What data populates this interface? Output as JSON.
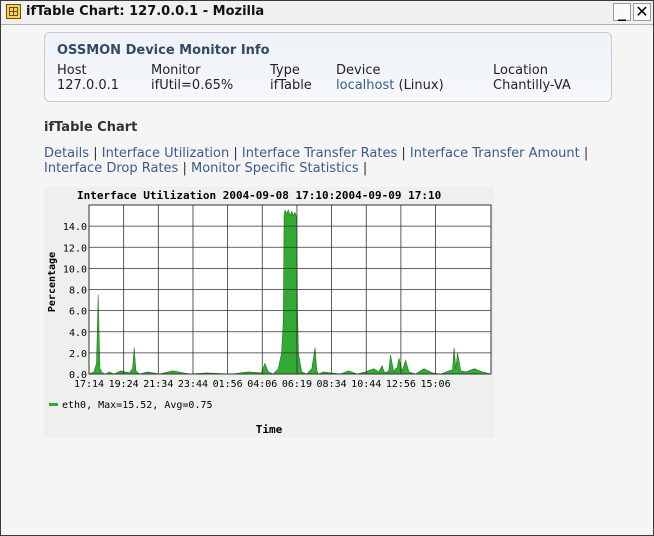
{
  "window": {
    "title": "ifTable Chart: 127.0.0.1 - Mozilla",
    "min_label": "_",
    "close_label": "✕"
  },
  "info": {
    "title": "OSSMON Device Monitor Info",
    "columns": [
      {
        "label": "Host",
        "value": "127.0.0.1"
      },
      {
        "label": "Monitor",
        "value": "ifUtil=0.65%"
      },
      {
        "label": "Type",
        "value": "ifTable"
      },
      {
        "label": "Device",
        "value_link": "localhost",
        "value_rest": " (Linux)"
      },
      {
        "label": "Location",
        "value": "Chantilly-VA"
      }
    ]
  },
  "section_title": "ifTable Chart",
  "nav_links": [
    "Details",
    "Interface Utilization",
    "Interface Transfer Rates",
    "Interface Transfer Amount",
    "Interface Drop Rates",
    "Monitor Specific Statistics"
  ],
  "nav_separator": "|",
  "colors": {
    "series": "#33aa33",
    "grid": "#333333",
    "plot_bg": "#ffffff",
    "link": "#3b5b8c"
  },
  "chart_data": {
    "type": "area",
    "title": "Interface Utilization 2004-09-08 17:10:2004-09-09 17:10",
    "xlabel": "Time",
    "ylabel": "Percentage",
    "ylim": [
      0,
      16
    ],
    "yticks": [
      "0.0",
      "2.0",
      "4.0",
      "6.0",
      "8.0",
      "10.0",
      "12.0",
      "14.0"
    ],
    "xlim": [
      0,
      24
    ],
    "xticks": [
      "17:14",
      "19:24",
      "21:34",
      "23:44",
      "01:56",
      "04:06",
      "06:19",
      "08:34",
      "10:44",
      "12:56",
      "15:06"
    ],
    "grid": true,
    "legend": {
      "placement": "bottom-left",
      "text": "eth0, Max=15.52, Avg=0.75"
    },
    "series": [
      {
        "name": "eth0",
        "x": [
          0,
          0.3,
          0.45,
          0.55,
          0.65,
          0.8,
          1.0,
          1.2,
          1.5,
          1.9,
          2.4,
          2.6,
          2.7,
          2.8,
          3.0,
          3.5,
          4.2,
          5.0,
          6.0,
          7.0,
          8.5,
          9.5,
          10.3,
          10.5,
          10.7,
          11.0,
          11.3,
          11.5,
          11.6,
          11.65,
          11.7,
          11.8,
          11.9,
          12.0,
          12.1,
          12.2,
          12.3,
          12.4,
          12.45,
          12.5,
          12.7,
          13.0,
          13.3,
          13.5,
          13.6,
          13.7,
          14.0,
          15.0,
          15.5,
          16.0,
          16.5,
          17.0,
          17.3,
          17.5,
          17.6,
          17.7,
          17.9,
          18.0,
          18.2,
          18.3,
          18.4,
          18.5,
          18.7,
          18.8,
          18.9,
          19.1,
          19.5,
          20.0,
          20.5,
          21.0,
          21.5,
          21.7,
          21.8,
          21.9,
          22.0,
          22.2,
          22.5,
          23.0,
          23.5,
          24.0
        ],
        "values": [
          0,
          0.2,
          1.0,
          7.5,
          0.5,
          0.1,
          0,
          0.2,
          0,
          0.3,
          0.1,
          0.5,
          2.5,
          0.3,
          0,
          0.2,
          0,
          0.3,
          0,
          0.1,
          0,
          0.2,
          0.1,
          1.0,
          0.2,
          0,
          0.5,
          2.0,
          5.0,
          15.0,
          15.5,
          15.2,
          15.52,
          15.0,
          15.4,
          15.0,
          15.3,
          14.8,
          6.0,
          2.0,
          0.2,
          0,
          0.5,
          2.5,
          0.3,
          0,
          0.2,
          0,
          0.3,
          0,
          0.2,
          0.5,
          0.2,
          0.8,
          0.3,
          0.1,
          0.3,
          1.8,
          0.2,
          0.5,
          0.6,
          1.5,
          0.3,
          0.8,
          1.3,
          0.2,
          0,
          0.5,
          0.1,
          0,
          0.3,
          0.4,
          2.5,
          0.5,
          2.0,
          0.3,
          0.2,
          0.5,
          0.2,
          0
        ]
      }
    ]
  }
}
